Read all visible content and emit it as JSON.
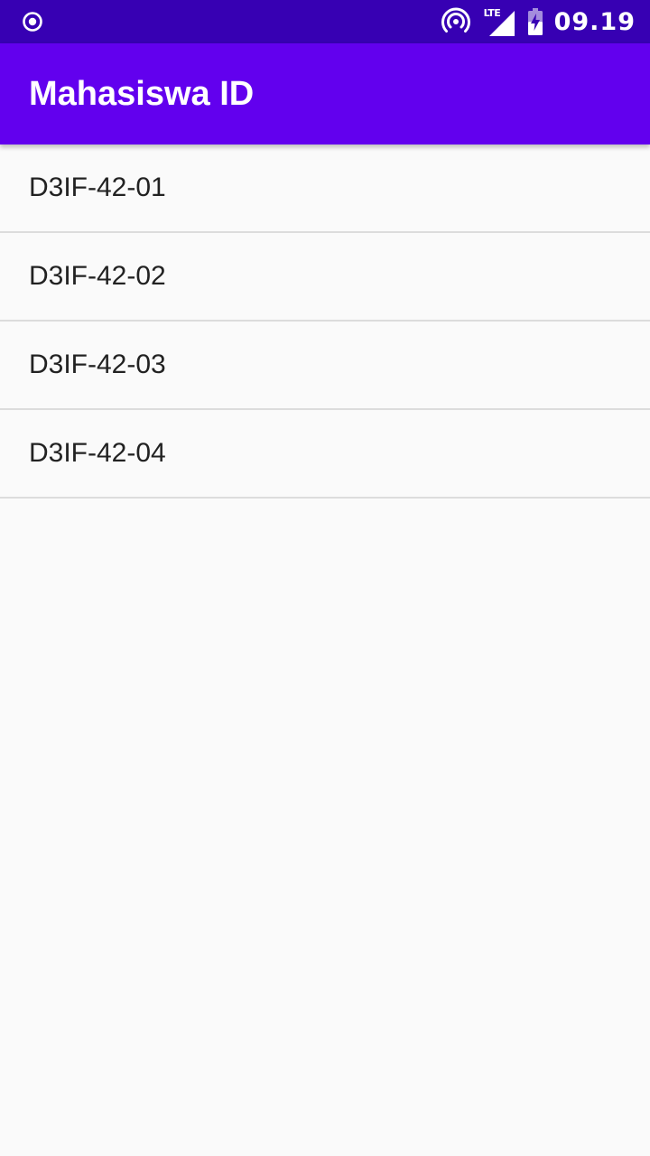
{
  "status_bar": {
    "time": "09.19",
    "network_type": "LTE",
    "left_icon": "radio-button-icon",
    "icons": [
      "hotspot-icon",
      "signal-icon",
      "battery-charging-icon"
    ]
  },
  "app_bar": {
    "title": "Mahasiswa ID"
  },
  "list": {
    "items": [
      {
        "label": "D3IF-42-01"
      },
      {
        "label": "D3IF-42-02"
      },
      {
        "label": "D3IF-42-03"
      },
      {
        "label": "D3IF-42-04"
      }
    ]
  },
  "colors": {
    "status_bar": "#3700b3",
    "app_bar": "#6200ee",
    "background": "#fafafa",
    "divider": "#dcdcdc",
    "text": "#222222"
  }
}
